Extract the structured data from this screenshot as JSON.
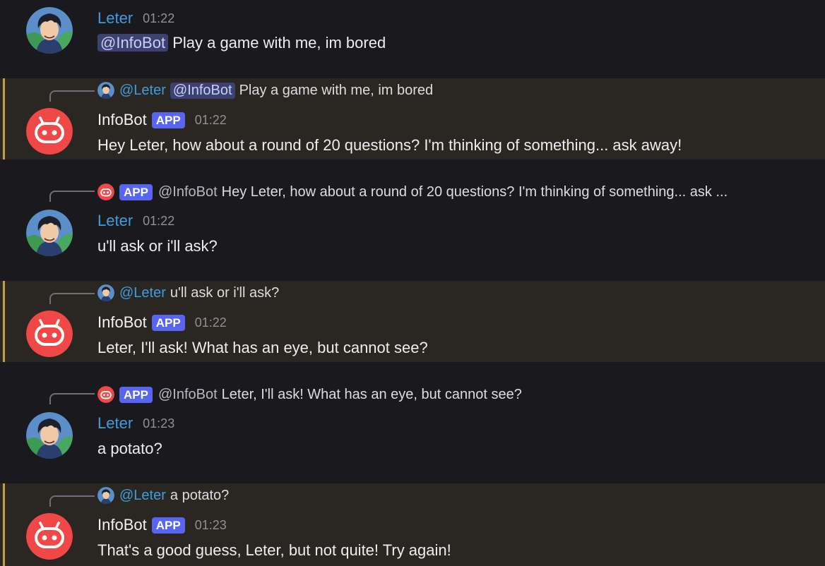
{
  "messages": [
    {
      "kind": "user",
      "name": "Leter",
      "time": "01:22",
      "mention": "@InfoBot",
      "text": "Play a game with me, im bored"
    },
    {
      "kind": "bot",
      "name": "InfoBot",
      "app": "APP",
      "time": "01:22",
      "reply_name": "@Leter",
      "reply_mention": "@InfoBot",
      "reply_text": "Play a game with me, im bored",
      "text": "Hey Leter, how about a round of 20 questions? I'm thinking of something... ask away!"
    },
    {
      "kind": "user",
      "name": "Leter",
      "time": "01:22",
      "reply_app": "APP",
      "reply_name": "@InfoBot",
      "reply_text": "Hey Leter, how about a round of 20 questions? I'm thinking of something... ask ...",
      "text": "u'll ask or i'll ask?"
    },
    {
      "kind": "bot",
      "name": "InfoBot",
      "app": "APP",
      "time": "01:22",
      "reply_name": "@Leter",
      "reply_text": "u'll ask or i'll ask?",
      "text": "Leter, I'll ask! What has an eye, but cannot see?"
    },
    {
      "kind": "user",
      "name": "Leter",
      "time": "01:23",
      "reply_app": "APP",
      "reply_name": "@InfoBot",
      "reply_text": "Leter, I'll ask! What has an eye, but cannot see?",
      "text": "a potato?"
    },
    {
      "kind": "bot",
      "name": "InfoBot",
      "app": "APP",
      "time": "01:23",
      "reply_name": "@Leter",
      "reply_text": "a potato?",
      "text": "That's a good guess, Leter, but not quite! Try again!"
    }
  ],
  "colors": {
    "bot_avatar": "#f04747",
    "user_name": "#3e9de0",
    "mention_bg": "#3c4270",
    "app_tag": "#5865f2",
    "highlight_bar": "#c99a4a"
  },
  "icons": {
    "user_avatar": "anime-avatar-icon",
    "bot_avatar": "robot-icon"
  }
}
